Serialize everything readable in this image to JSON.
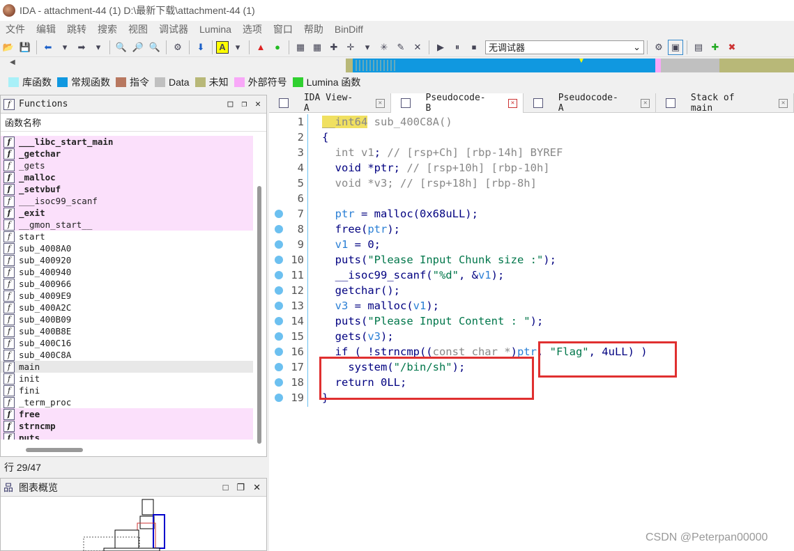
{
  "window": {
    "title": "IDA - attachment-44 (1) D:\\最新下载\\attachment-44 (1)"
  },
  "menu": [
    "文件",
    "编辑",
    "跳转",
    "搜索",
    "视图",
    "调试器",
    "Lumina",
    "选项",
    "窗口",
    "帮助",
    "BinDiff"
  ],
  "toolbar": {
    "debugger_select": "无调试器"
  },
  "legend": [
    {
      "label": "库函数",
      "color": "#a8f0f8"
    },
    {
      "label": "常规函数",
      "color": "#1098e0"
    },
    {
      "label": "指令",
      "color": "#b87860"
    },
    {
      "label": "Data",
      "color": "#c0c0c0"
    },
    {
      "label": "未知",
      "color": "#b8b878"
    },
    {
      "label": "外部符号",
      "color": "#f8a8f8"
    },
    {
      "label": "Lumina 函数",
      "color": "#30d030"
    }
  ],
  "functions_panel": {
    "title": "Functions",
    "column_header": "函数名称",
    "rows": [
      {
        "name": "___libc_start_main",
        "style": "lib"
      },
      {
        "name": "_getchar",
        "style": "lib"
      },
      {
        "name": "_gets",
        "style": "libn"
      },
      {
        "name": "_malloc",
        "style": "lib"
      },
      {
        "name": "_setvbuf",
        "style": "lib"
      },
      {
        "name": "___isoc99_scanf",
        "style": "libn"
      },
      {
        "name": "_exit",
        "style": "lib"
      },
      {
        "name": "__gmon_start__",
        "style": "libn"
      },
      {
        "name": "start",
        "style": ""
      },
      {
        "name": "sub_4008A0",
        "style": ""
      },
      {
        "name": "sub_400920",
        "style": ""
      },
      {
        "name": "sub_400940",
        "style": ""
      },
      {
        "name": "sub_400966",
        "style": ""
      },
      {
        "name": "sub_4009E9",
        "style": ""
      },
      {
        "name": "sub_400A2C",
        "style": ""
      },
      {
        "name": "sub_400B09",
        "style": ""
      },
      {
        "name": "sub_400B8E",
        "style": ""
      },
      {
        "name": "sub_400C16",
        "style": ""
      },
      {
        "name": "sub_400C8A",
        "style": ""
      },
      {
        "name": "main",
        "style": "sel"
      },
      {
        "name": "init",
        "style": ""
      },
      {
        "name": "fini",
        "style": ""
      },
      {
        "name": "_term_proc",
        "style": ""
      },
      {
        "name": "free",
        "style": "lib"
      },
      {
        "name": "strncmp",
        "style": "lib"
      },
      {
        "name": "puts",
        "style": "lib"
      }
    ],
    "row_status": "行 29/47"
  },
  "graph_panel": {
    "title": "图表概览"
  },
  "tabs": [
    {
      "label": "IDA View-A",
      "active": false
    },
    {
      "label": "Pseudocode-B",
      "active": true
    },
    {
      "label": "Pseudocode-A",
      "active": false
    },
    {
      "label": "Stack of main",
      "active": false
    }
  ],
  "code_lines": [
    {
      "n": "1",
      "dot": false,
      "html": "<span class=\"hl gray\">__int64</span> <span class=\"gray\">sub_400C8A()</span>"
    },
    {
      "n": "2",
      "dot": false,
      "html": "{"
    },
    {
      "n": "3",
      "dot": false,
      "html": "  <span class=\"gray\">int</span> <span class=\"gray\">v1</span>; <span class=\"gray\">// [rsp+Ch] [rbp-14h] BYREF</span>"
    },
    {
      "n": "4",
      "dot": false,
      "html": "  void *ptr; <span class=\"gray\">// [rsp+10h] [rbp-10h]</span>"
    },
    {
      "n": "5",
      "dot": false,
      "html": "  <span class=\"gray\">void *v3; // [rsp+18h] [rbp-8h]</span>"
    },
    {
      "n": "6",
      "dot": false,
      "html": ""
    },
    {
      "n": "7",
      "dot": true,
      "html": "  <span class=\"var\">ptr</span> = malloc(0x68uLL);"
    },
    {
      "n": "8",
      "dot": true,
      "html": "  free(<span class=\"var\">ptr</span>);"
    },
    {
      "n": "9",
      "dot": true,
      "html": "  <span class=\"var\">v1</span> = 0;"
    },
    {
      "n": "10",
      "dot": true,
      "html": "  puts(<span class=\"str\">\"Please Input Chunk size :\"</span>);"
    },
    {
      "n": "11",
      "dot": true,
      "html": "  __isoc99_scanf(<span class=\"str\">\"%d\"</span>, &amp;<span class=\"var\">v1</span>);"
    },
    {
      "n": "12",
      "dot": true,
      "html": "  getchar();"
    },
    {
      "n": "13",
      "dot": true,
      "html": "  <span class=\"var\">v3</span> = malloc(<span class=\"var\">v1</span>);"
    },
    {
      "n": "14",
      "dot": true,
      "html": "  puts(<span class=\"str\">\"Please Input Content : \"</span>);"
    },
    {
      "n": "15",
      "dot": true,
      "html": "  gets(<span class=\"var\">v3</span>);"
    },
    {
      "n": "16",
      "dot": true,
      "html": "  if ( !strncmp((<span class=\"gray\">const char *</span>)<span class=\"var\">ptr</span>, <span class=\"str\">\"Flag\"</span>, 4uLL) )"
    },
    {
      "n": "17",
      "dot": true,
      "html": "    system(<span class=\"str\">\"/bin/sh\"</span>);"
    },
    {
      "n": "18",
      "dot": true,
      "html": "  return 0LL;"
    },
    {
      "n": "19",
      "dot": true,
      "html": "}"
    }
  ],
  "watermark": "CSDN @Peterpan00000"
}
